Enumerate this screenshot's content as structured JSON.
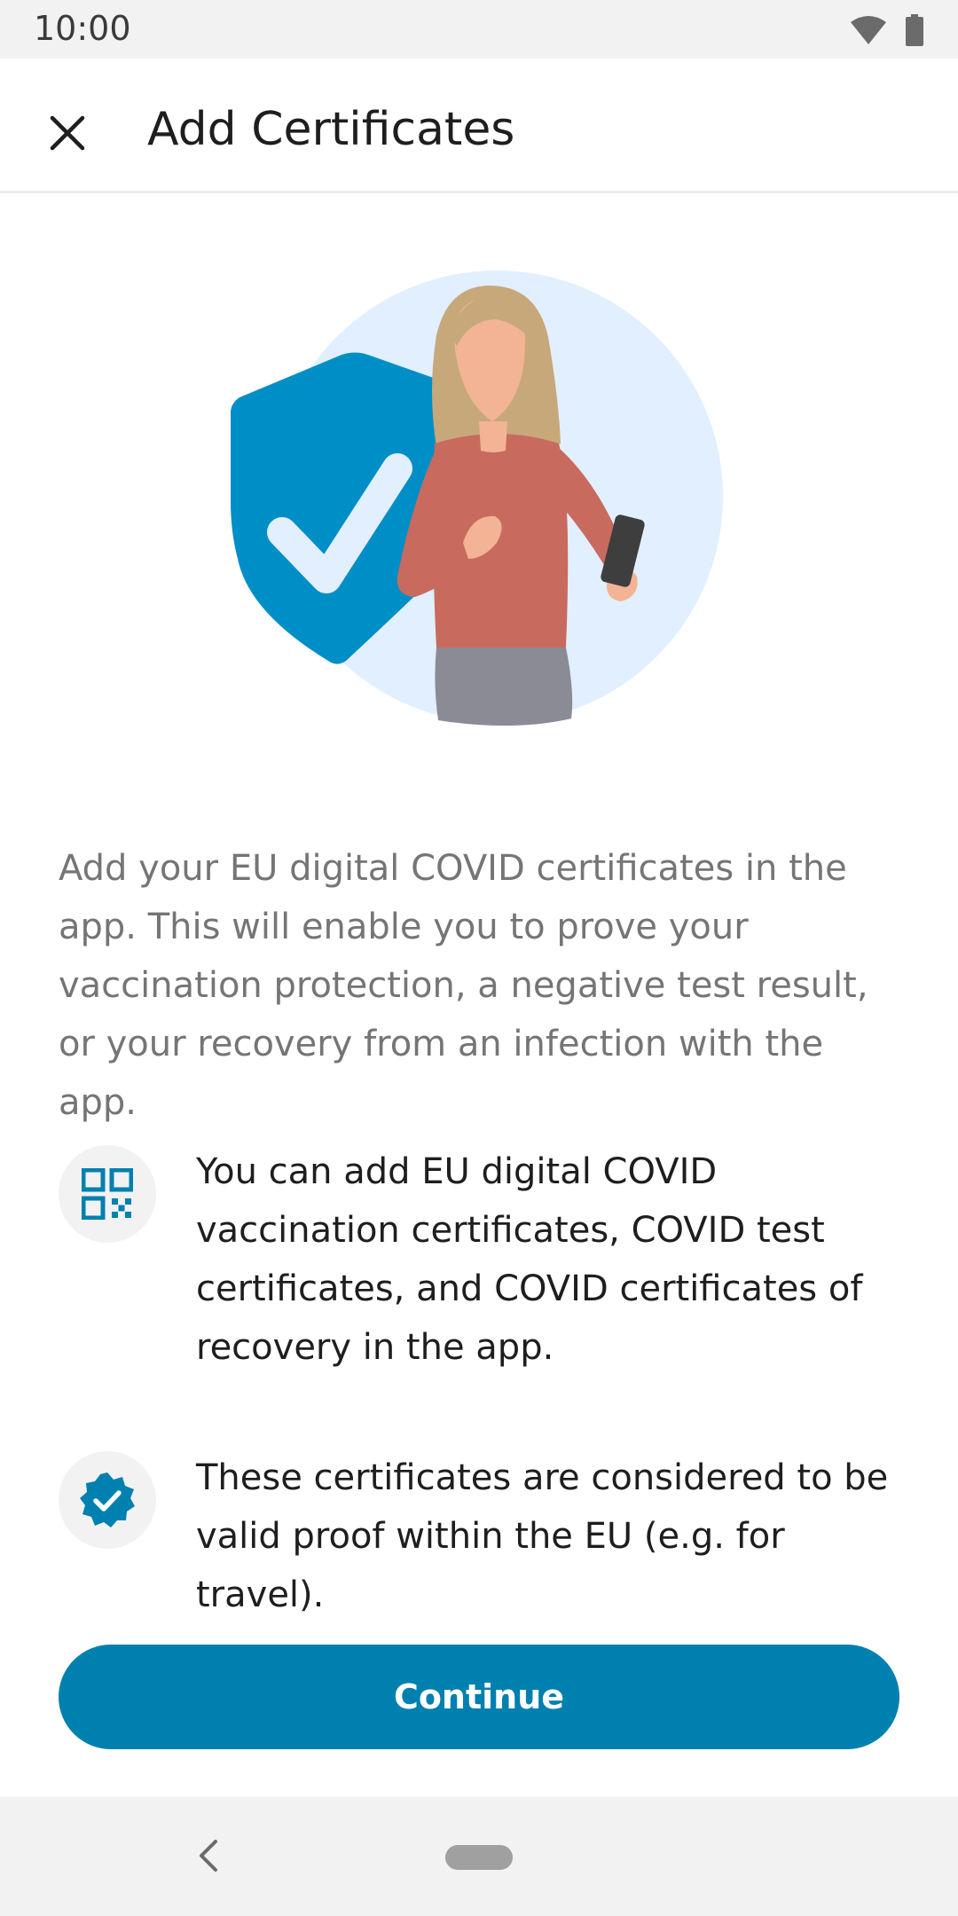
{
  "status_bar": {
    "time": "10:00"
  },
  "app_bar": {
    "title": "Add Certificates"
  },
  "intro": "Add your EU digital COVID certificates in the app. This will enable you to prove your vaccination protection, a negative test result, or your recovery from an infection with the app.",
  "features": [
    {
      "icon": "qr-code-icon",
      "text": "You can add EU digital COVID vaccination certificates, COVID test certificates, and COVID certificates of recovery in the app."
    },
    {
      "icon": "verified-badge-icon",
      "text": "These certificates are considered to be valid proof within the EU (e.g. for travel)."
    }
  ],
  "continue_label": "Continue",
  "colors": {
    "accent": "#0080af",
    "shield": "#008ec6",
    "circle_bg": "#e1efff",
    "shirt": "#c96a5e"
  }
}
